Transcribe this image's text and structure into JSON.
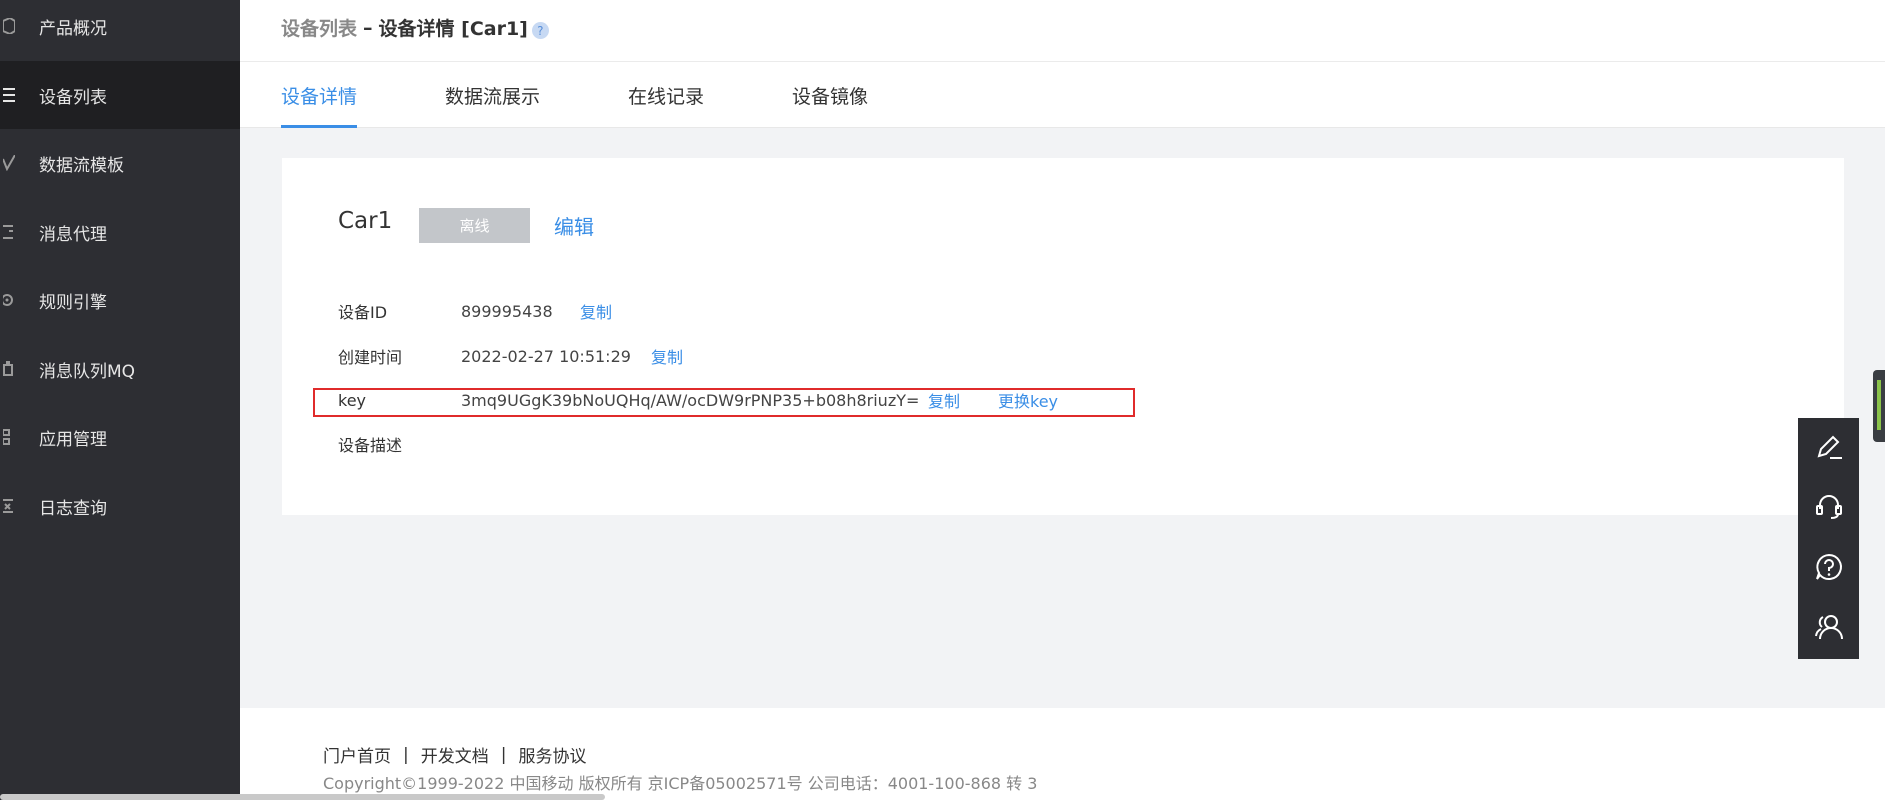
{
  "sidebar": {
    "items": [
      {
        "label": "产品概况",
        "icon": "cube-icon",
        "active": false
      },
      {
        "label": "设备列表",
        "icon": "list-icon",
        "active": true
      },
      {
        "label": "数据流模板",
        "icon": "trend-icon",
        "active": false
      },
      {
        "label": "消息代理",
        "icon": "message-icon",
        "active": false
      },
      {
        "label": "规则引擎",
        "icon": "gear-icon",
        "active": false
      },
      {
        "label": "消息队列MQ",
        "icon": "queue-icon",
        "active": false
      },
      {
        "label": "应用管理",
        "icon": "grid-icon",
        "active": false
      },
      {
        "label": "日志查询",
        "icon": "log-icon",
        "active": false
      }
    ]
  },
  "header": {
    "breadcrumb_parent": "设备列表",
    "breadcrumb_sep": "–",
    "breadcrumb_current": "设备详情 [Car1]",
    "help": "?"
  },
  "tabs": [
    {
      "label": "设备详情",
      "active": true
    },
    {
      "label": "数据流展示",
      "active": false
    },
    {
      "label": "在线记录",
      "active": false
    },
    {
      "label": "设备镜像",
      "active": false
    }
  ],
  "device": {
    "name": "Car1",
    "status": "离线",
    "edit_label": "编辑",
    "fields": {
      "id_label": "设备ID",
      "id_value": "899995438",
      "created_label": "创建时间",
      "created_value": "2022-02-27 10:51:29",
      "key_label": "key",
      "key_value": "3mq9UGgK39bNoUQHq/AW/ocDW9rPNP35+b08h8riuzY=",
      "desc_label": "设备描述",
      "desc_value": ""
    },
    "copy_label": "复制",
    "replace_key_label": "更换key"
  },
  "footer": {
    "links": [
      "门户首页",
      "开发文档",
      "服务协议"
    ],
    "separator": "|",
    "copyright": "Copyright©1999-2022 中国移动 版权所有 京ICP备05002571号 公司电话：4001-100-868 转 3"
  },
  "float_tools": [
    "edit-icon",
    "headset-icon",
    "help-icon",
    "users-icon"
  ],
  "colors": {
    "accent": "#3a8ee6",
    "sidebar_bg": "#2d2e33",
    "highlight_border": "#e02b2b",
    "status_offline": "#c3c6ca"
  }
}
